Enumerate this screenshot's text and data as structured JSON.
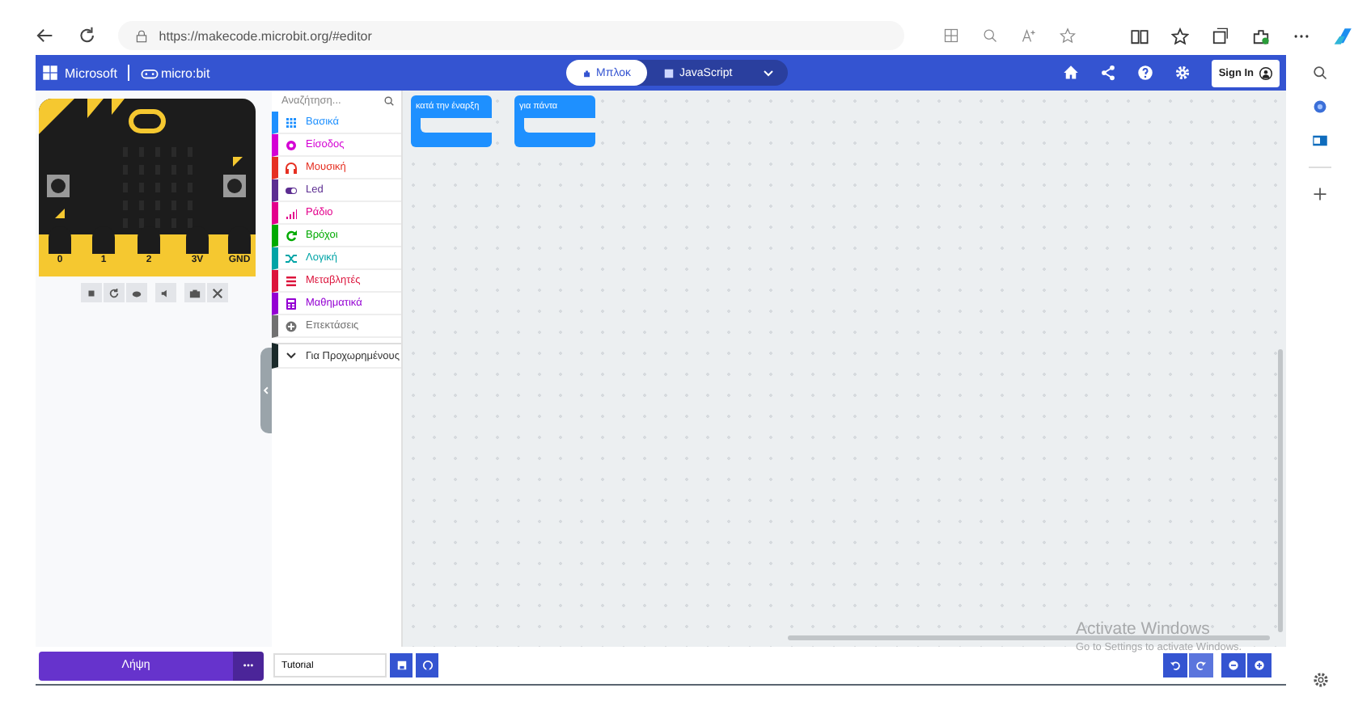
{
  "browser": {
    "url": "https://makecode.microbit.org/#editor"
  },
  "header": {
    "brand": "Microsoft",
    "product": "micro:bit",
    "sign_in": "Sign In",
    "tabs": [
      {
        "label": "Μπλοκ",
        "selected": true
      },
      {
        "label": "JavaScript",
        "selected": false
      }
    ]
  },
  "simulator": {
    "pins": [
      "0",
      "1",
      "2",
      "3V",
      "GND"
    ]
  },
  "toolbox": {
    "search_placeholder": "Αναζήτηση...",
    "categories": [
      {
        "kind": "category",
        "label": "Βασικά",
        "color": "#1e90ff"
      },
      {
        "kind": "category",
        "label": "Είσοδος",
        "color": "#d400d4"
      },
      {
        "kind": "category",
        "label": "Μουσική",
        "color": "#e63022"
      },
      {
        "kind": "category",
        "label": "Led",
        "color": "#5c2d91"
      },
      {
        "kind": "category",
        "label": "Ράδιο",
        "color": "#e3008c"
      },
      {
        "kind": "category",
        "label": "Βρόχοι",
        "color": "#00aa00"
      },
      {
        "kind": "category",
        "label": "Λογική",
        "color": "#00a4a6"
      },
      {
        "kind": "category",
        "label": "Μεταβλητές",
        "color": "#dc143c"
      },
      {
        "kind": "category",
        "label": "Μαθηματικά",
        "color": "#9400d3"
      },
      {
        "kind": "category",
        "label": "Επεκτάσεις",
        "color": "#717171"
      },
      {
        "kind": "advanced",
        "label": "Για Προχωρημένους",
        "color": "#1a2a2a"
      }
    ]
  },
  "blocks": [
    {
      "label": "κατά την έναρξη"
    },
    {
      "label": "για πάντα"
    }
  ],
  "download": {
    "label": "Λήψη"
  },
  "project": {
    "value": "Tutorial"
  },
  "notice": {
    "title": "Activate Windows",
    "subtitle": "Go to Settings to activate Windows."
  }
}
